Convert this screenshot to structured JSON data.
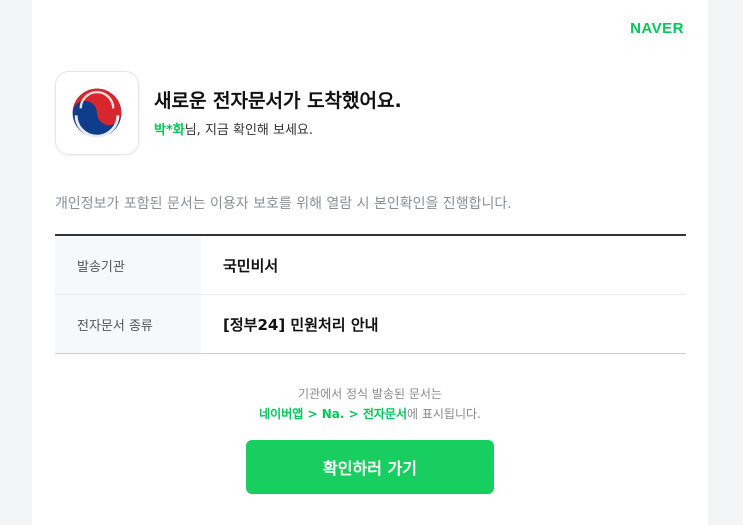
{
  "brand": "NAVER",
  "notification": {
    "headline": "새로운 전자문서가 도착했어요.",
    "recipient_name": "박*화",
    "subline_rest": "님, 지금 확인해 보세요."
  },
  "privacy_notice": "개인정보가 포함된 문서는 이용자 보호를 위해 열람 시 본인확인을 진행합니다.",
  "details": [
    {
      "label": "발송기관",
      "value": "국민비서"
    },
    {
      "label": "전자문서 종류",
      "value": "[정부24] 민원처리 안내"
    }
  ],
  "note": {
    "line1": "기관에서 정식 발송된 문서는",
    "path": "네이버앱 > Na. > 전자문서",
    "line2_rest": "에 표시됩니다."
  },
  "cta_label": "확인하러 가기",
  "icons": {
    "sender_logo": "korea-government-emblem-icon"
  },
  "colors": {
    "accent": "#03c75a",
    "button": "#19ce60"
  }
}
